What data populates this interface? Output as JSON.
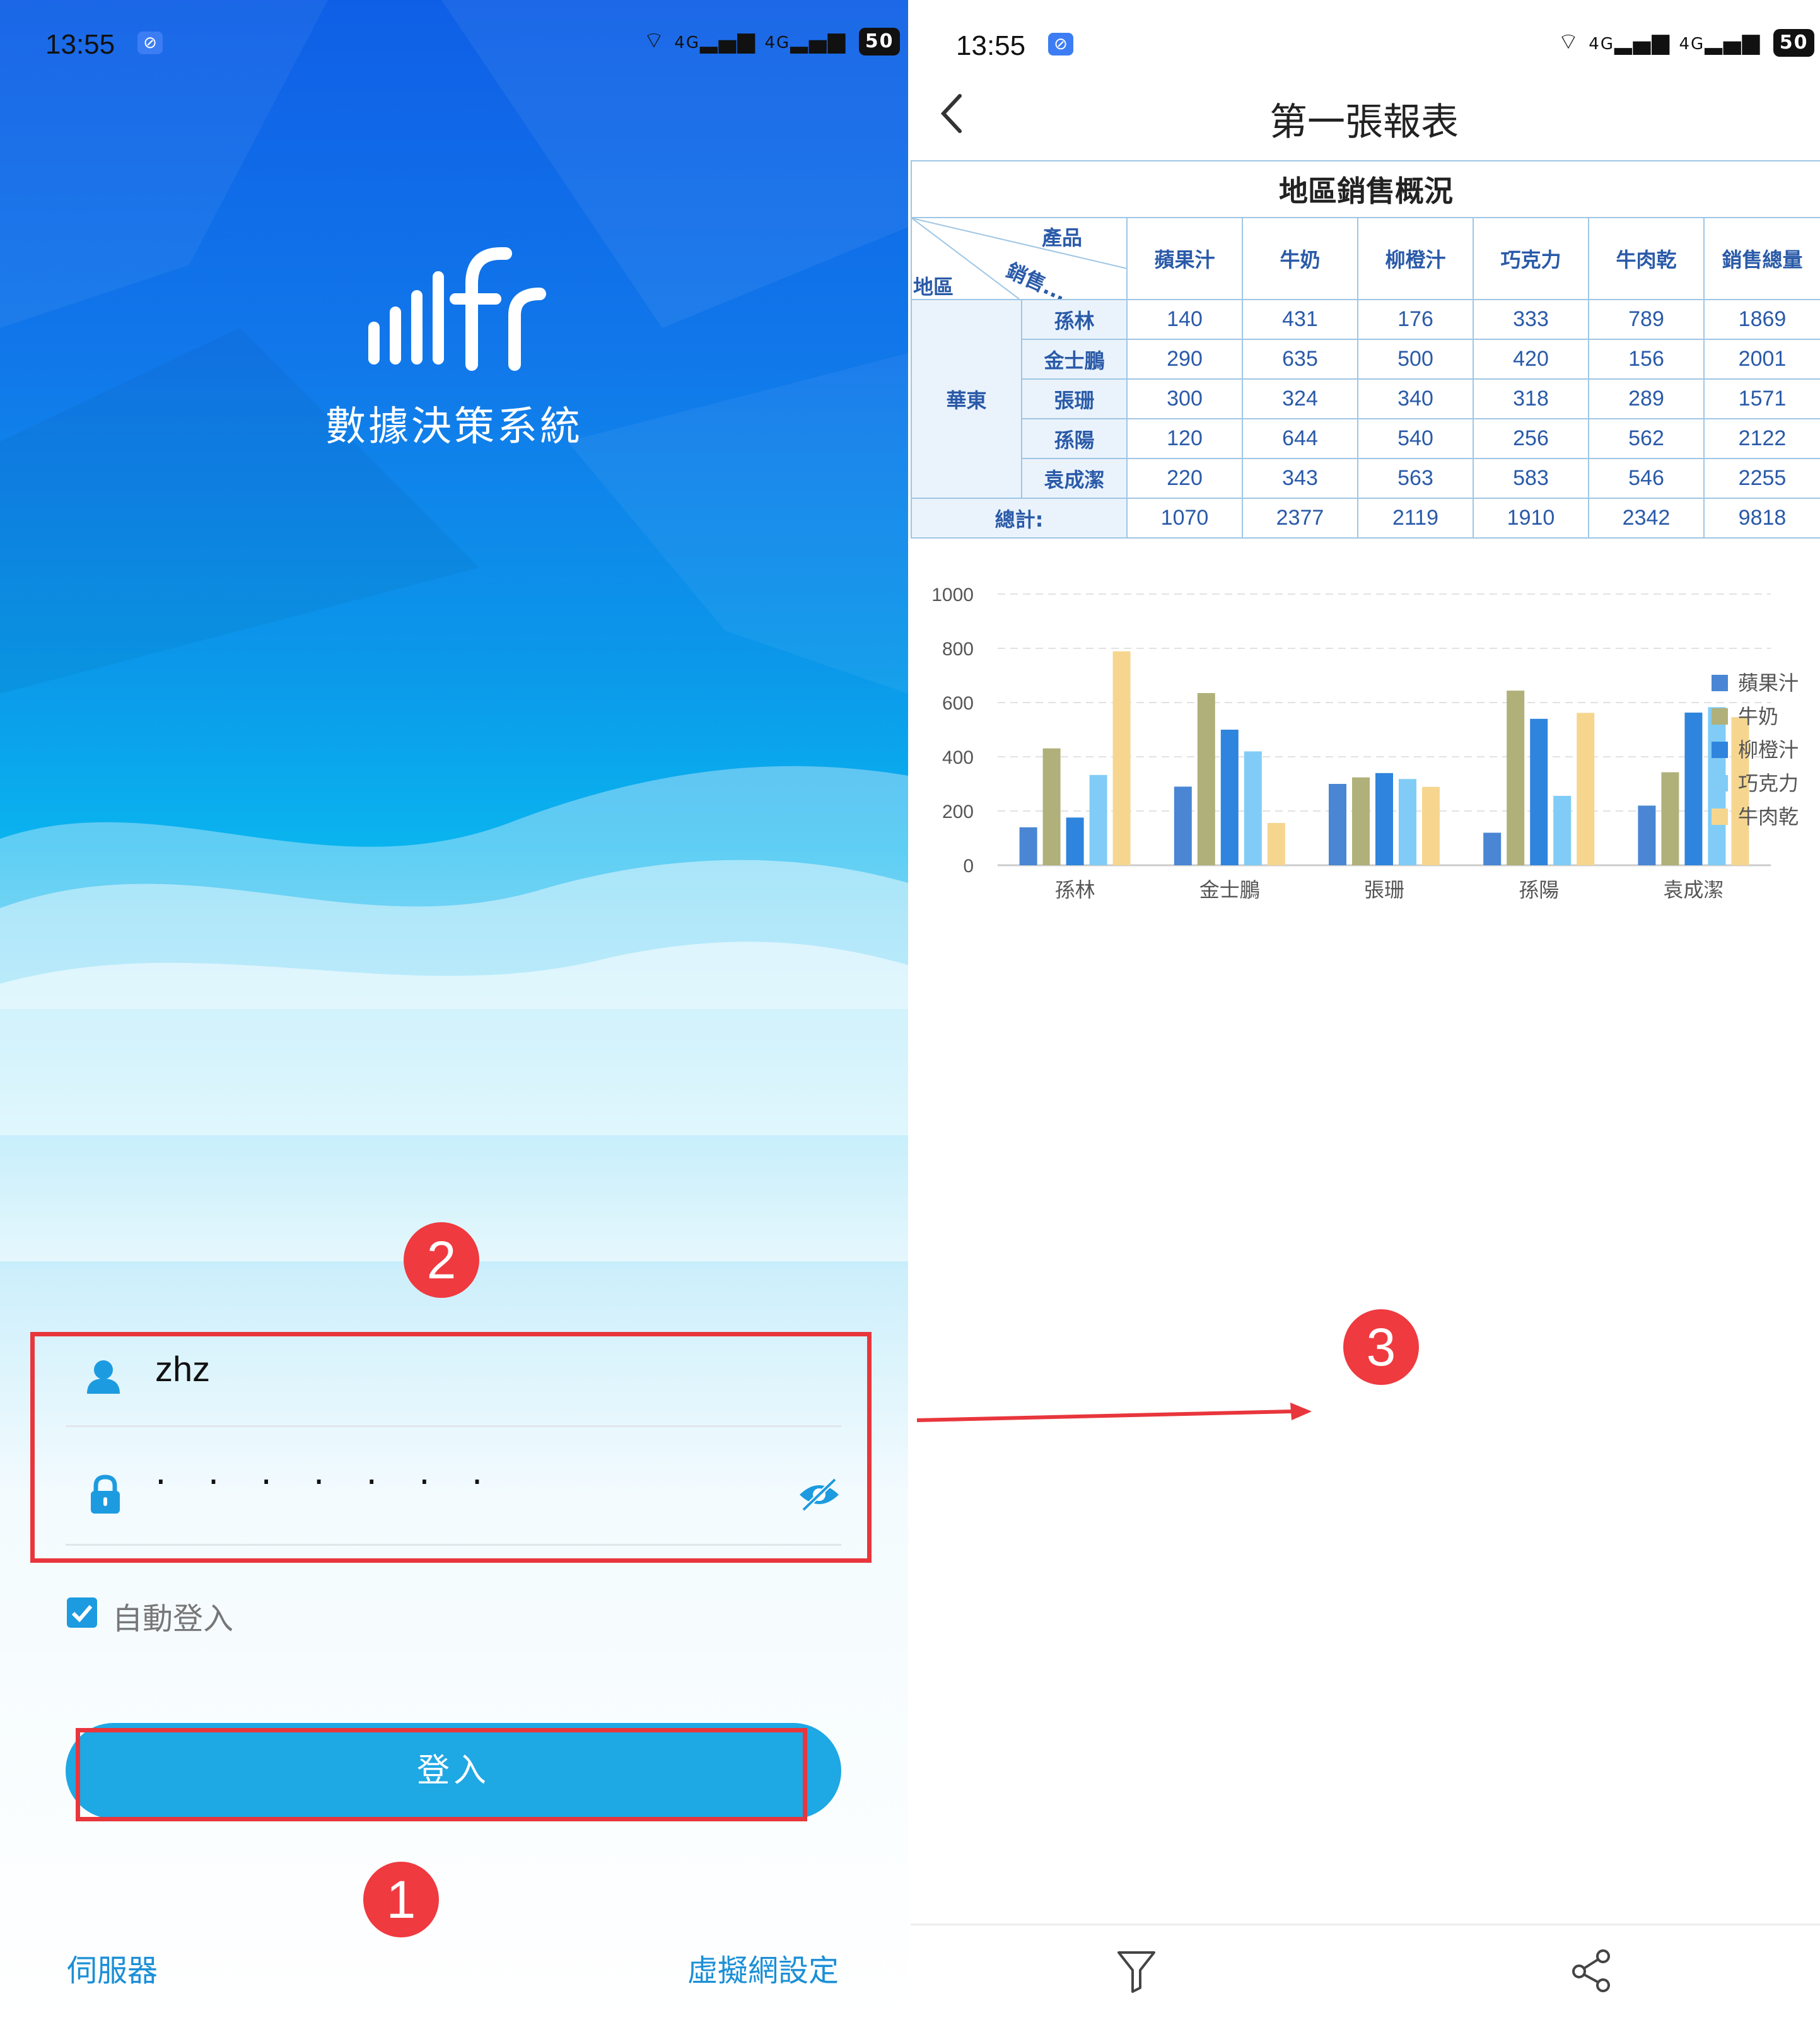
{
  "login": {
    "status_time": "13:55",
    "status_net": "4G",
    "battery": "50",
    "app_title": "數據決策系統",
    "username": "zhz",
    "password_mask": "· · · · · · ·",
    "auto_login_label": "自動登入",
    "login_button": "登入",
    "server_link": "伺服器",
    "vpn_link": "虛擬網設定"
  },
  "annotations": {
    "one": "1",
    "two": "2",
    "three": "3"
  },
  "report": {
    "status_time": "13:55",
    "status_net": "4G",
    "battery": "50",
    "title": "第一張報表",
    "table_title": "地區銷售概況",
    "corner_product": "產品",
    "corner_sales": "銷售...",
    "corner_region": "地區",
    "columns": [
      "蘋果汁",
      "牛奶",
      "柳橙汁",
      "巧克力",
      "牛肉乾",
      "銷售總量"
    ],
    "region": "華東",
    "rows": [
      {
        "name": "孫林",
        "values": [
          "140",
          "431",
          "176",
          "333",
          "789",
          "1869"
        ]
      },
      {
        "name": "金士鵬",
        "values": [
          "290",
          "635",
          "500",
          "420",
          "156",
          "2001"
        ]
      },
      {
        "name": "張珊",
        "values": [
          "300",
          "324",
          "340",
          "318",
          "289",
          "1571"
        ]
      },
      {
        "name": "孫陽",
        "values": [
          "120",
          "644",
          "540",
          "256",
          "562",
          "2122"
        ]
      },
      {
        "name": "袁成潔",
        "values": [
          "220",
          "343",
          "563",
          "583",
          "546",
          "2255"
        ]
      }
    ],
    "total_label": "總計:",
    "totals": [
      "1070",
      "2377",
      "2119",
      "1910",
      "2342",
      "9818"
    ]
  },
  "chart_data": {
    "type": "bar",
    "categories": [
      "孫林",
      "金士鵬",
      "張珊",
      "孫陽",
      "袁成潔"
    ],
    "series": [
      {
        "name": "蘋果汁",
        "color": "#4a86d3",
        "values": [
          140,
          290,
          300,
          120,
          220
        ]
      },
      {
        "name": "牛奶",
        "color": "#b0b07a",
        "values": [
          431,
          635,
          324,
          644,
          343
        ]
      },
      {
        "name": "柳橙汁",
        "color": "#2f84dd",
        "values": [
          176,
          500,
          340,
          540,
          563
        ]
      },
      {
        "name": "巧克力",
        "color": "#80ccf6",
        "values": [
          333,
          420,
          318,
          256,
          583
        ]
      },
      {
        "name": "牛肉乾",
        "color": "#f6d68f",
        "values": [
          789,
          156,
          289,
          562,
          546
        ]
      }
    ],
    "ylim": [
      0,
      1000
    ],
    "yticks": [
      0,
      200,
      400,
      600,
      800,
      1000
    ],
    "grid": true,
    "legend": "right"
  }
}
